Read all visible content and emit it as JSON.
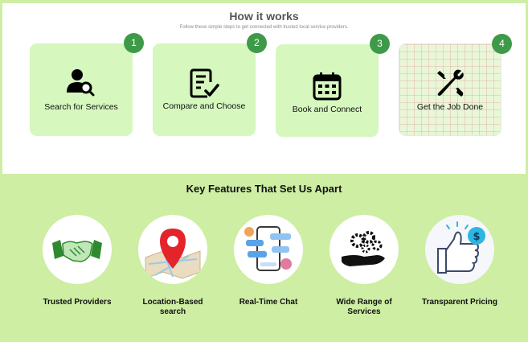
{
  "how_it_works": {
    "title": "How it works",
    "subtitle": "Follow these simple steps to get connected with trusted local service providers.",
    "steps": [
      {
        "number": "1",
        "label": "Search for Services",
        "icon": "user-search-icon"
      },
      {
        "number": "2",
        "label": "Compare and Choose",
        "icon": "checklist-icon"
      },
      {
        "number": "3",
        "label": "Book and Connect",
        "icon": "calendar-icon"
      },
      {
        "number": "4",
        "label": "Get the Job Done",
        "icon": "tools-icon"
      }
    ]
  },
  "features": {
    "title": "Key Features That Set Us Apart",
    "items": [
      {
        "label": "Trusted Providers",
        "icon": "handshake-icon"
      },
      {
        "label": "Location-Based search",
        "icon": "map-pin-icon"
      },
      {
        "label": "Real-Time Chat",
        "icon": "chat-icon"
      },
      {
        "label": "Wide Range of Services",
        "icon": "gears-hand-icon"
      },
      {
        "label": "Transparent Pricing",
        "icon": "thumbs-up-dollar-icon"
      }
    ]
  },
  "colors": {
    "accent_green": "#3e9a48",
    "card_bg": "#d6f7be",
    "section_bg": "#cdeea3"
  }
}
